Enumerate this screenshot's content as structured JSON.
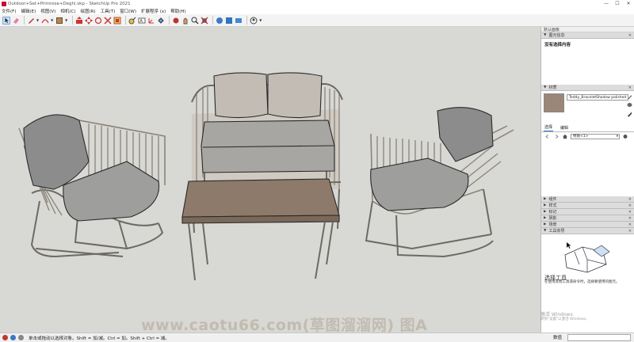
{
  "window": {
    "title": "Outdoor+Set+Primrose+Deghi.skp - SketchUp Pro 2021",
    "controls": [
      "—",
      "☐",
      "✕"
    ]
  },
  "menu": [
    "文件(F)",
    "编辑(E)",
    "视图(V)",
    "相机(C)",
    "绘图(R)",
    "工具(T)",
    "窗口(W)",
    "扩展程序 (x)",
    "帮助(H)"
  ],
  "toolbar": {
    "tools": [
      "select-icon",
      "eraser-icon",
      "pencil-icon",
      "arc-icon",
      "rectangle-icon",
      "push-pull-icon",
      "move-icon",
      "rotate-icon",
      "scale-icon",
      "offset-icon",
      "tape-measure-icon",
      "text-icon",
      "axes-icon",
      "paint-bucket-icon",
      "orbit-icon",
      "pan-icon",
      "zoom-icon",
      "zoom-extents-icon",
      "warehouse-icon",
      "extension-warehouse-icon",
      "layout-icon",
      "account-icon"
    ]
  },
  "panel": {
    "title": "默认面板",
    "entity_info": {
      "header": "图元信息",
      "body": "没有选择内容"
    },
    "materials": {
      "header": "材质",
      "name": "Teddy_BraceletShadow polished",
      "tabs": [
        "选择",
        "编辑"
      ],
      "active_tab": "选择",
      "dropdown": "材质<1>",
      "swatch_color": "#9c8679"
    },
    "collapsed": [
      "组件",
      "样式",
      "标记",
      "阴影",
      "场景"
    ],
    "instructor": {
      "header": "工具向导",
      "title": "选择工具",
      "desc": "在使用其他工具或命令时，选择要使用的图元。"
    }
  },
  "watermark": {
    "main": "www.caotu66.com(草图溜溜网) 图A",
    "windows": "激活 Windows",
    "windows_sub": "转到\"设置\"以激活 Windows。"
  },
  "status": {
    "hint": "单击或拖动以选择对象。Shift = 加/减。Ctrl = 加。Shift + Ctrl = 减。",
    "vcb_label": "数值"
  }
}
